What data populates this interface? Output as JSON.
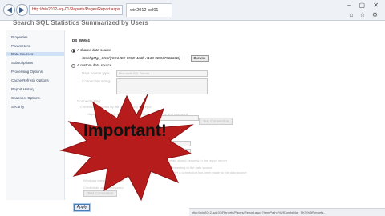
{
  "browser": {
    "back_glyph": "◀",
    "forward_glyph": "▶",
    "address": "http://win2012-sql-01/Reports/Pages/Report.aspx...",
    "tab_title": "win2012-sql01",
    "window_controls": "–  ▢  ✕",
    "toolbar_icons": "⌂ ☆ ⚙"
  },
  "page": {
    "title": "Search SQL Statistics Summarized by Users"
  },
  "sidebar": {
    "items": [
      {
        "label": "Properties"
      },
      {
        "label": "Parameters"
      },
      {
        "label": "Data Sources"
      },
      {
        "label": "Subscriptions"
      },
      {
        "label": "Processing Options"
      },
      {
        "label": "Cache Refresh Options"
      },
      {
        "label": "Report History"
      },
      {
        "label": "Snapshot Options"
      },
      {
        "label": "Security"
      }
    ]
  },
  "main": {
    "section_title": "DS_WMv4",
    "shared_label": "A shared data source",
    "shared_path": "/ConfigMgr_SKS/{ICE14E2-998E-4a3b-A133-9DD6790260D}",
    "browse_label": "Browse",
    "custom_label": "A custom data source",
    "data_source_type_label": "Data source type:",
    "data_source_type_value": "Microsoft SQL Server",
    "connection_string_label": "Connection string:",
    "connect_using_label": "Connect using:",
    "credentials_hint": "Credentials supplied by the user running the report",
    "prompt_hint": "Display the following text to prompt user for a user name and password:",
    "test_connection_label": "Test Connection",
    "stored_hint": "Credentials stored securely in the report server",
    "windows_hint": "Use as Windows credentials when connecting to the data source",
    "impersonate_hint": "Impersonate the authenticated user after a connection has been made to the data source",
    "integrated_hint": "Windows integrated security",
    "not_required_hint": "Credentials are not required",
    "apply_label": "Apply"
  },
  "overlay": {
    "text": "Important!",
    "star_color": "#b71c1c"
  },
  "status_bar": {
    "text": "http://win2012-sql-01/Reports/Pages/Report.aspx?ItemPath=%2fConfigMgr_SKS%2fReports..."
  }
}
